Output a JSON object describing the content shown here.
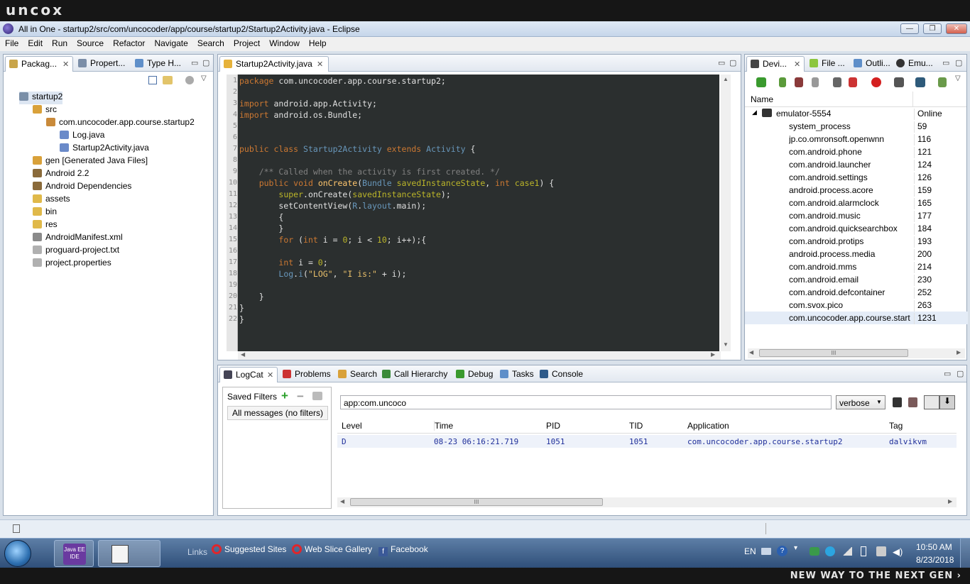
{
  "brand": "uncox",
  "slogan": "NEW WAY TO THE NEXT GEN ›",
  "window": {
    "title": "All in One - startup2/src/com/uncocoder/app/course/startup2/Startup2Activity.java - Eclipse"
  },
  "menu": [
    "File",
    "Edit",
    "Run",
    "Source",
    "Refactor",
    "Navigate",
    "Search",
    "Project",
    "Window",
    "Help"
  ],
  "left_view": {
    "tabs": [
      "Packag...",
      "Propert...",
      "Type H..."
    ],
    "tree": [
      {
        "label": "startup2",
        "indent": 0,
        "icon": "project-icon"
      },
      {
        "label": "src",
        "indent": 1,
        "icon": "source-folder-icon"
      },
      {
        "label": "com.uncocoder.app.course.startup2",
        "indent": 2,
        "icon": "package-icon"
      },
      {
        "label": "Log.java",
        "indent": 3,
        "icon": "java-file-icon"
      },
      {
        "label": "Startup2Activity.java",
        "indent": 3,
        "icon": "java-file-icon"
      },
      {
        "label": "gen [Generated Java Files]",
        "indent": 1,
        "icon": "source-folder-icon"
      },
      {
        "label": "Android 2.2",
        "indent": 1,
        "icon": "library-icon"
      },
      {
        "label": "Android Dependencies",
        "indent": 1,
        "icon": "library-icon"
      },
      {
        "label": "assets",
        "indent": 1,
        "icon": "folder-icon"
      },
      {
        "label": "bin",
        "indent": 1,
        "icon": "folder-icon"
      },
      {
        "label": "res",
        "indent": 1,
        "icon": "folder-icon"
      },
      {
        "label": "AndroidManifest.xml",
        "indent": 1,
        "icon": "xml-file-icon"
      },
      {
        "label": "proguard-project.txt",
        "indent": 1,
        "icon": "text-file-icon"
      },
      {
        "label": "project.properties",
        "indent": 1,
        "icon": "text-file-icon"
      }
    ]
  },
  "editor": {
    "tab": "Startup2Activity.java",
    "line_numbers": [
      "1",
      "2",
      "3",
      "4",
      "5",
      "6",
      "7",
      "8",
      "9",
      "10",
      "11",
      "12",
      "13",
      "14",
      "15",
      "16",
      "17",
      "18",
      "19",
      "20",
      "21",
      "22"
    ]
  },
  "devices": {
    "tabs": [
      "Devi...",
      "File ...",
      "Outli...",
      "Emu..."
    ],
    "columns": [
      "Name",
      ""
    ],
    "emulator": {
      "name": "emulator-5554",
      "status": "Online"
    },
    "processes": [
      {
        "name": "system_process",
        "pid": "59"
      },
      {
        "name": "jp.co.omronsoft.openwnn",
        "pid": "116"
      },
      {
        "name": "com.android.phone",
        "pid": "121"
      },
      {
        "name": "com.android.launcher",
        "pid": "124"
      },
      {
        "name": "com.android.settings",
        "pid": "126"
      },
      {
        "name": "android.process.acore",
        "pid": "159"
      },
      {
        "name": "com.android.alarmclock",
        "pid": "165"
      },
      {
        "name": "com.android.music",
        "pid": "177"
      },
      {
        "name": "com.android.quicksearchbox",
        "pid": "184"
      },
      {
        "name": "com.android.protips",
        "pid": "193"
      },
      {
        "name": "android.process.media",
        "pid": "200"
      },
      {
        "name": "com.android.mms",
        "pid": "214"
      },
      {
        "name": "com.android.email",
        "pid": "230"
      },
      {
        "name": "com.android.defcontainer",
        "pid": "252"
      },
      {
        "name": "com.svox.pico",
        "pid": "263"
      },
      {
        "name": "com.uncocoder.app.course.start",
        "pid": "1231"
      }
    ],
    "hscroll_label": "III"
  },
  "bottom": {
    "tabs": [
      "LogCat",
      "Problems",
      "Search",
      "Call Hierarchy",
      "Debug",
      "Tasks",
      "Console"
    ],
    "saved_filters_title": "Saved Filters",
    "filter_item": "All messages (no filters)",
    "search_value": "app:com.uncoco",
    "level_select": "verbose",
    "columns": [
      "Level",
      "Time",
      "PID",
      "TID",
      "Application",
      "Tag"
    ],
    "rows": [
      {
        "level": "D",
        "time": "08-23 06:16:21.719",
        "pid": "1051",
        "tid": "1051",
        "app": "com.uncocoder.app.course.startup2",
        "tag": "dalvikvm"
      }
    ],
    "hscroll_label": "III"
  },
  "taskbar": {
    "links_label": "Links",
    "links": [
      "Suggested Sites",
      "Web Slice Gallery",
      "Facebook"
    ],
    "lang": "EN",
    "time": "10:50 AM",
    "date": "8/23/2018",
    "javaee_label": "Java EE IDE"
  },
  "colors": {
    "accent": "#2f4f79",
    "editor_bg": "#2b2f2f",
    "workbench": "#d9e1ea"
  }
}
